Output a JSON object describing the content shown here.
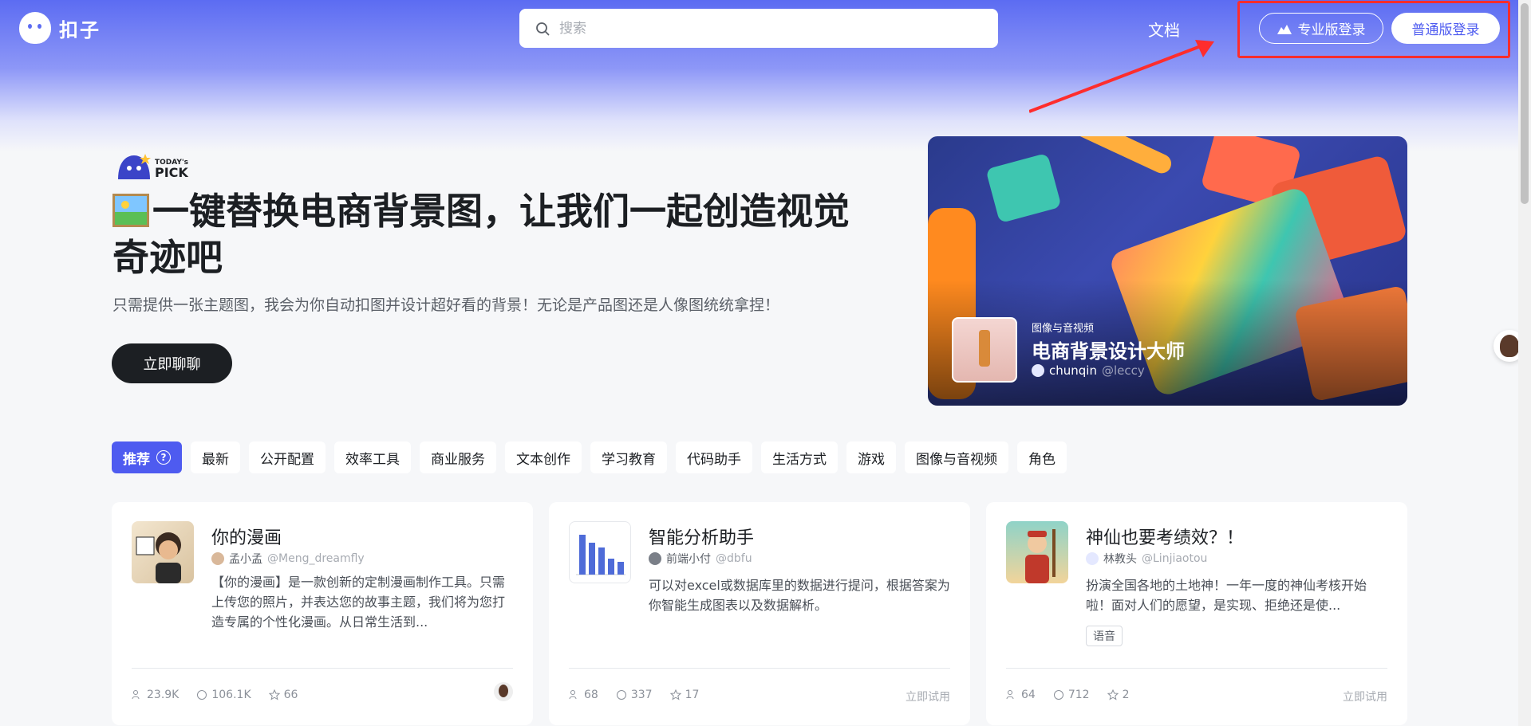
{
  "header": {
    "brand": "扣子",
    "search_placeholder": "搜索",
    "docs_label": "文档",
    "pro_login_label": "专业版登录",
    "normal_login_label": "普通版登录"
  },
  "hero": {
    "pick_small": "TODAY's",
    "pick_large": "PICK",
    "title": "一键替换电商背景图，让我们一起创造视觉奇迹吧",
    "subtitle": "只需提供一张主题图，我会为你自动扣图并设计超好看的背景！无论是产品图还是人像图统统拿捏！",
    "cta_label": "立即聊聊"
  },
  "banner": {
    "category": "图像与音视频",
    "title": "电商背景设计大师",
    "author": "chunqin",
    "handle": "@leccy"
  },
  "tabs": [
    {
      "label": "推荐",
      "active": true
    },
    {
      "label": "最新"
    },
    {
      "label": "公开配置"
    },
    {
      "label": "效率工具"
    },
    {
      "label": "商业服务"
    },
    {
      "label": "文本创作"
    },
    {
      "label": "学习教育"
    },
    {
      "label": "代码助手"
    },
    {
      "label": "生活方式"
    },
    {
      "label": "游戏"
    },
    {
      "label": "图像与音视频"
    },
    {
      "label": "角色"
    }
  ],
  "cards": [
    {
      "title": "你的漫画",
      "author": "孟小孟",
      "handle": "@Meng_dreamfly",
      "description": "【你的漫画】是一款创新的定制漫画制作工具。只需上传您的照片，并表达您的故事主题，我们将为您打造专属的个性化漫画。从日常生活到...",
      "users": "23.9K",
      "chats": "106.1K",
      "favorites": "66"
    },
    {
      "title": "智能分析助手",
      "author": "前端小付",
      "handle": "@dbfu",
      "description": "可以对excel或数据库里的数据进行提问，根据答案为你智能生成图表以及数据解析。",
      "users": "68",
      "chats": "337",
      "favorites": "17",
      "try_label": "立即试用"
    },
    {
      "title": "神仙也要考绩效？！",
      "author": "林教头",
      "handle": "@Linjiaotou",
      "description": "扮演全国各地的土地神！一年一度的神仙考核开始啦！面对人们的愿望，是实现、拒绝还是使...",
      "tag": "语音",
      "users": "64",
      "chats": "712",
      "favorites": "2",
      "try_label": "立即试用"
    }
  ],
  "colors": {
    "accent": "#4e5bf0",
    "highlight_box": "#ff2d2d",
    "dark_button": "#1c1f23"
  }
}
